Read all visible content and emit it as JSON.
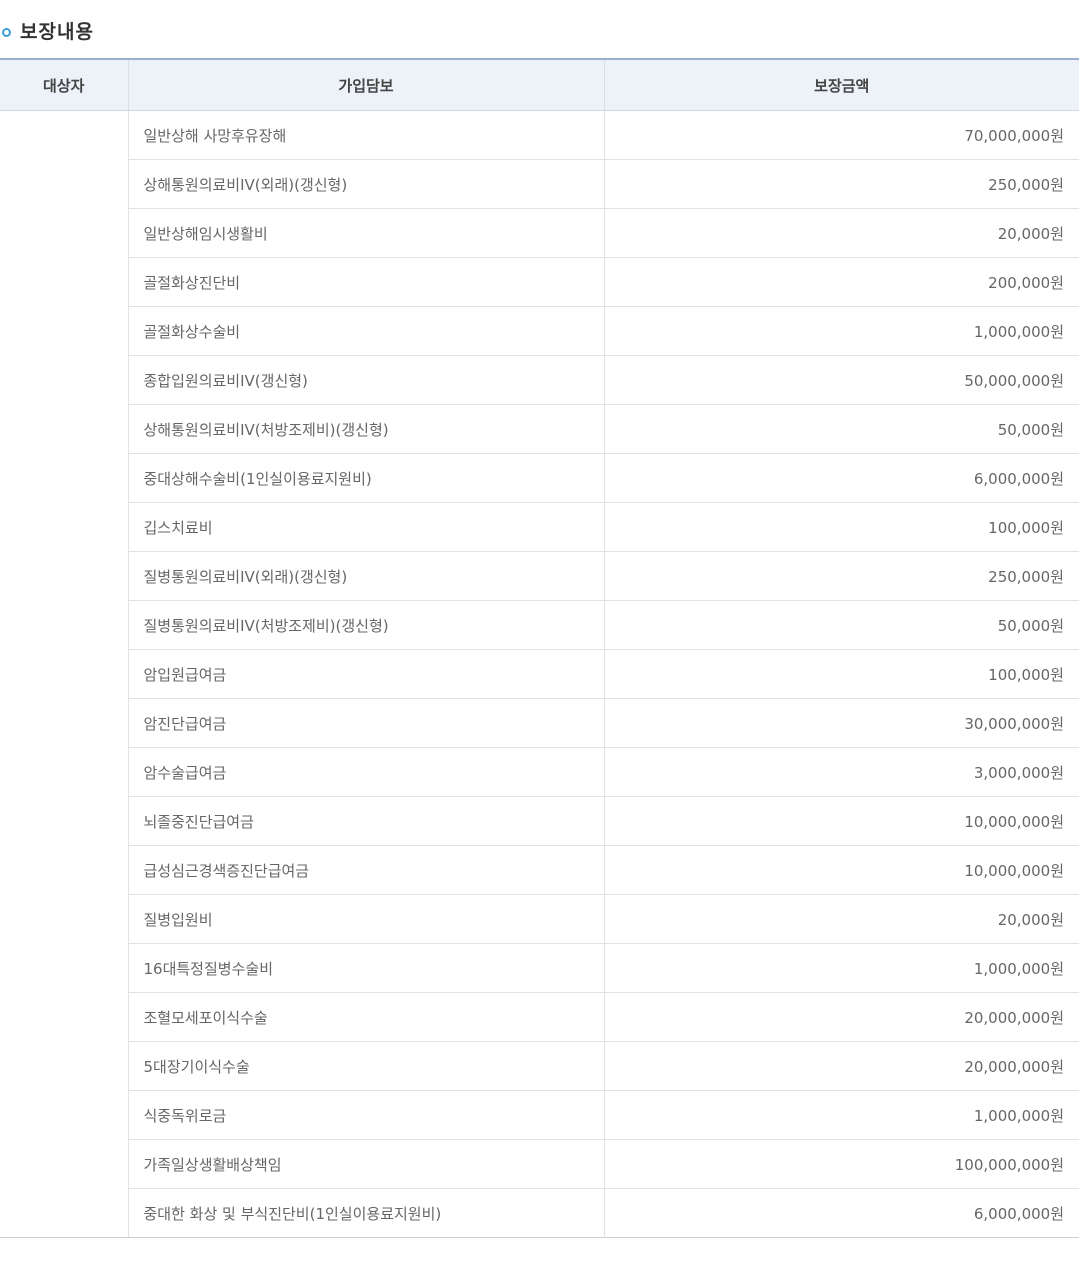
{
  "section": {
    "title": "보장내용",
    "bullet_icon": "circle-bullet-icon",
    "bullet_color": "#3aa0dc"
  },
  "table": {
    "headers": {
      "subject": "대상자",
      "coverage": "가입담보",
      "amount": "보장금액"
    },
    "subject": "",
    "rows": [
      {
        "coverage": "일반상해 사망후유장해",
        "amount": "70,000,000원"
      },
      {
        "coverage": "상해통원의료비IV(외래)(갱신형)",
        "amount": "250,000원"
      },
      {
        "coverage": "일반상해임시생활비",
        "amount": "20,000원"
      },
      {
        "coverage": "골절화상진단비",
        "amount": "200,000원"
      },
      {
        "coverage": "골절화상수술비",
        "amount": "1,000,000원"
      },
      {
        "coverage": "종합입원의료비IV(갱신형)",
        "amount": "50,000,000원"
      },
      {
        "coverage": "상해통원의료비IV(처방조제비)(갱신형)",
        "amount": "50,000원"
      },
      {
        "coverage": "중대상해수술비(1인실이용료지원비)",
        "amount": "6,000,000원"
      },
      {
        "coverage": "깁스치료비",
        "amount": "100,000원"
      },
      {
        "coverage": "질병통원의료비IV(외래)(갱신형)",
        "amount": "250,000원"
      },
      {
        "coverage": "질병통원의료비IV(처방조제비)(갱신형)",
        "amount": "50,000원"
      },
      {
        "coverage": "암입원급여금",
        "amount": "100,000원"
      },
      {
        "coverage": "암진단급여금",
        "amount": "30,000,000원"
      },
      {
        "coverage": "암수술급여금",
        "amount": "3,000,000원"
      },
      {
        "coverage": "뇌졸중진단급여금",
        "amount": "10,000,000원"
      },
      {
        "coverage": "급성심근경색증진단급여금",
        "amount": "10,000,000원"
      },
      {
        "coverage": "질병입원비",
        "amount": "20,000원"
      },
      {
        "coverage": "16대특정질병수술비",
        "amount": "1,000,000원"
      },
      {
        "coverage": "조혈모세포이식수술",
        "amount": "20,000,000원"
      },
      {
        "coverage": "5대장기이식수술",
        "amount": "20,000,000원"
      },
      {
        "coverage": "식중독위로금",
        "amount": "1,000,000원"
      },
      {
        "coverage": "가족일상생활배상책임",
        "amount": "100,000,000원"
      },
      {
        "coverage": "중대한 화상 및 부식진단비(1인실이용료지원비)",
        "amount": "6,000,000원"
      }
    ]
  }
}
